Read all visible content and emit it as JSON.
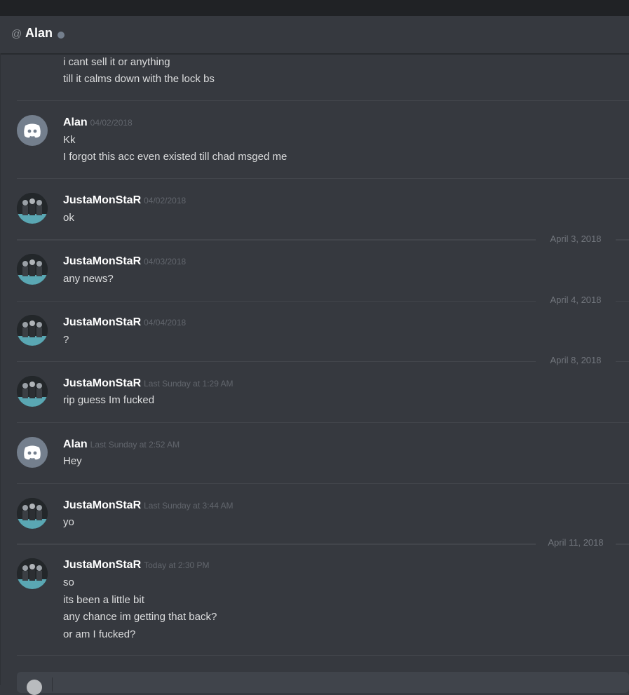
{
  "header": {
    "at_symbol": "@",
    "title": "Alan"
  },
  "messages": [
    {
      "author": "",
      "timestamp": "",
      "avatar": "",
      "lines": [
        "i cant sell it or anything",
        "till it calms down with the lock bs"
      ]
    },
    {
      "author": "Alan",
      "timestamp": "04/02/2018",
      "avatar": "discord-default-icon",
      "lines": [
        "Kk",
        "I forgot this acc even existed till chad msged me"
      ]
    },
    {
      "author": "JustaMonStaR",
      "timestamp": "04/02/2018",
      "avatar": "group-photo-avatar",
      "lines": [
        "ok"
      ]
    },
    {
      "author": "JustaMonStaR",
      "timestamp": "04/03/2018",
      "avatar": "group-photo-avatar",
      "lines": [
        "any news?"
      ]
    },
    {
      "author": "JustaMonStaR",
      "timestamp": "04/04/2018",
      "avatar": "group-photo-avatar",
      "lines": [
        "?"
      ]
    },
    {
      "author": "JustaMonStaR",
      "timestamp": "Last Sunday at 1:29 AM",
      "avatar": "group-photo-avatar",
      "lines": [
        "rip guess Im fucked"
      ]
    },
    {
      "author": "Alan",
      "timestamp": "Last Sunday at 2:52 AM",
      "avatar": "discord-default-icon",
      "lines": [
        "Hey"
      ]
    },
    {
      "author": "JustaMonStaR",
      "timestamp": "Last Sunday at 3:44 AM",
      "avatar": "group-photo-avatar",
      "lines": [
        "yo"
      ]
    },
    {
      "author": "JustaMonStaR",
      "timestamp": "Today at 2:30 PM",
      "avatar": "group-photo-avatar",
      "lines": [
        "so",
        "its been a little bit",
        "any chance im getting that back?",
        "or am I fucked?"
      ]
    }
  ],
  "date_dividers": [
    "April 3, 2018",
    "April 4, 2018",
    "April 8, 2018",
    "April 11, 2018"
  ],
  "colors": {
    "background": "#36393f",
    "header": "#36393f",
    "username": "#ffffff",
    "timestamp": "#62666d",
    "status_offline": "#747f8d"
  }
}
